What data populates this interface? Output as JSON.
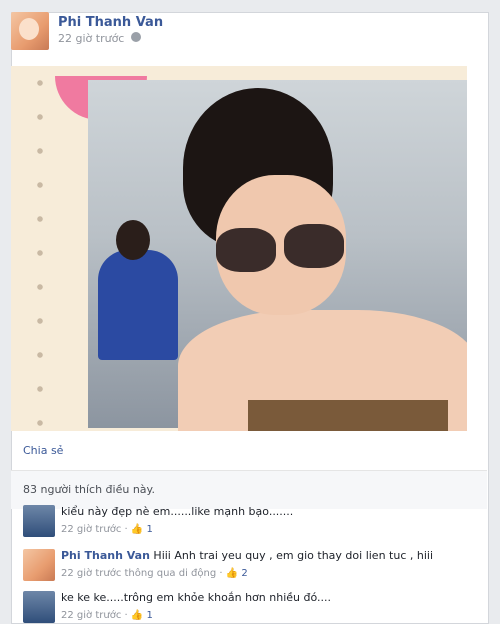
{
  "post": {
    "author": "Phi Thanh Van",
    "time": "22 giờ trước",
    "share_label": "Chia sẻ",
    "likes_text": "83 người thích điều này."
  },
  "comments": [
    {
      "author": "",
      "text": "kiểu này đẹp nè em......like mạnh bạo.......",
      "time": "22 giờ trước",
      "likes": "1"
    },
    {
      "author": "Phi Thanh Van",
      "text": "Hiii Anh trai yeu quy , em gio thay doi lien tuc , hiii",
      "time": "22 giờ trước thông qua di động",
      "likes": "2"
    },
    {
      "author": "",
      "text": "ke ke ke.....trông em khỏe khoắn hơn nhiều đó....",
      "time": "22 giờ trước",
      "likes": "1"
    }
  ],
  "icons": {
    "globe": "globe-icon",
    "thumb": "thumbs-up-icon"
  },
  "colors": {
    "link": "#3b5998",
    "meta": "#90949c"
  }
}
